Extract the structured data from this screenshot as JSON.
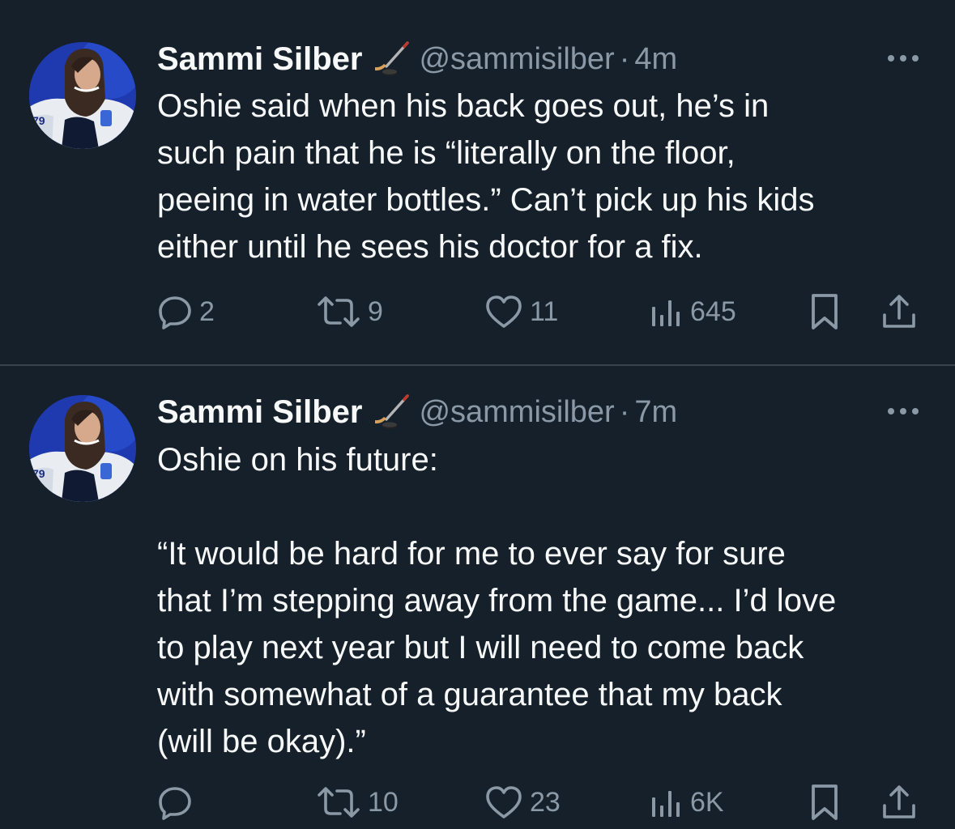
{
  "tweets": [
    {
      "author": "Sammi Silber",
      "handle": "@sammisilber",
      "separator": "·",
      "time": "4m",
      "text": "Oshie said when his back goes out, he’s in\nsuch pain that he is “literally on the floor,\npeeing in water bottles.” Can’t pick up his kids\neither until he sees his doctor for a fix.",
      "replies": "2",
      "retweets": "9",
      "likes": "11",
      "views": "645"
    },
    {
      "author": "Sammi Silber",
      "handle": "@sammisilber",
      "separator": "·",
      "time": "7m",
      "text": "Oshie on his future:\n\n“It would be hard for me to ever say for sure\nthat I’m stepping away from the game... I’d love\nto play next year but I will need to come back\nwith somewhat of a guarantee that my back\n(will be okay).”",
      "replies": "",
      "retweets": "10",
      "likes": "23",
      "views": "6K"
    }
  ],
  "icons": {
    "author_emoji": "hockey-stick-and-puck-icon",
    "more": "more-horizontal-icon",
    "reply": "reply-icon",
    "retweet": "retweet-icon",
    "like": "heart-icon",
    "views": "views-bar-chart-icon",
    "bookmark": "bookmark-icon",
    "share": "share-icon"
  },
  "colors": {
    "background": "#15202b",
    "text": "#f7f9f9",
    "secondary": "#8b98a5",
    "divider": "#38444d"
  }
}
